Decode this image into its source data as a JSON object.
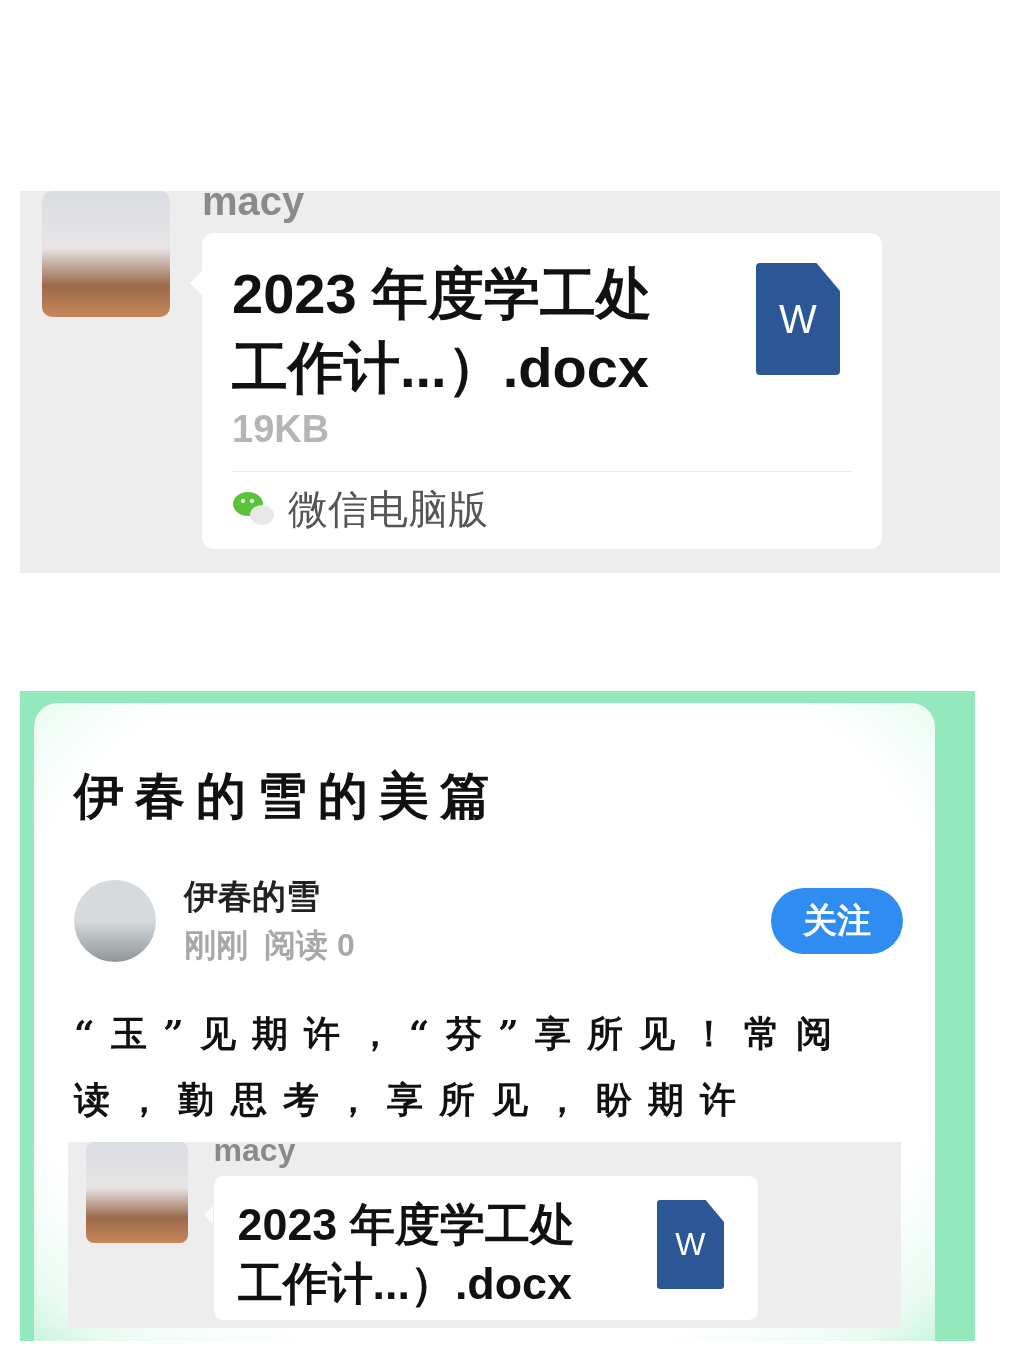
{
  "chat_message": {
    "sender": "macy",
    "file_name": "2023 年度学工处工作计...）.docx",
    "file_size": "19KB",
    "file_icon_letter": "W",
    "source": "微信电脑版"
  },
  "article": {
    "title": "伊春的雪的美篇",
    "author": "伊春的雪",
    "time": "刚刚",
    "reads": "阅读 0",
    "follow_button": "关注",
    "body": "“玉”见期许，“芬”享所见！常阅读，勤思考，享所见，盼期许",
    "embedded_message": {
      "sender": "macy",
      "file_name": "2023 年度学工处工作计...）.docx",
      "file_icon_letter": "W"
    }
  }
}
